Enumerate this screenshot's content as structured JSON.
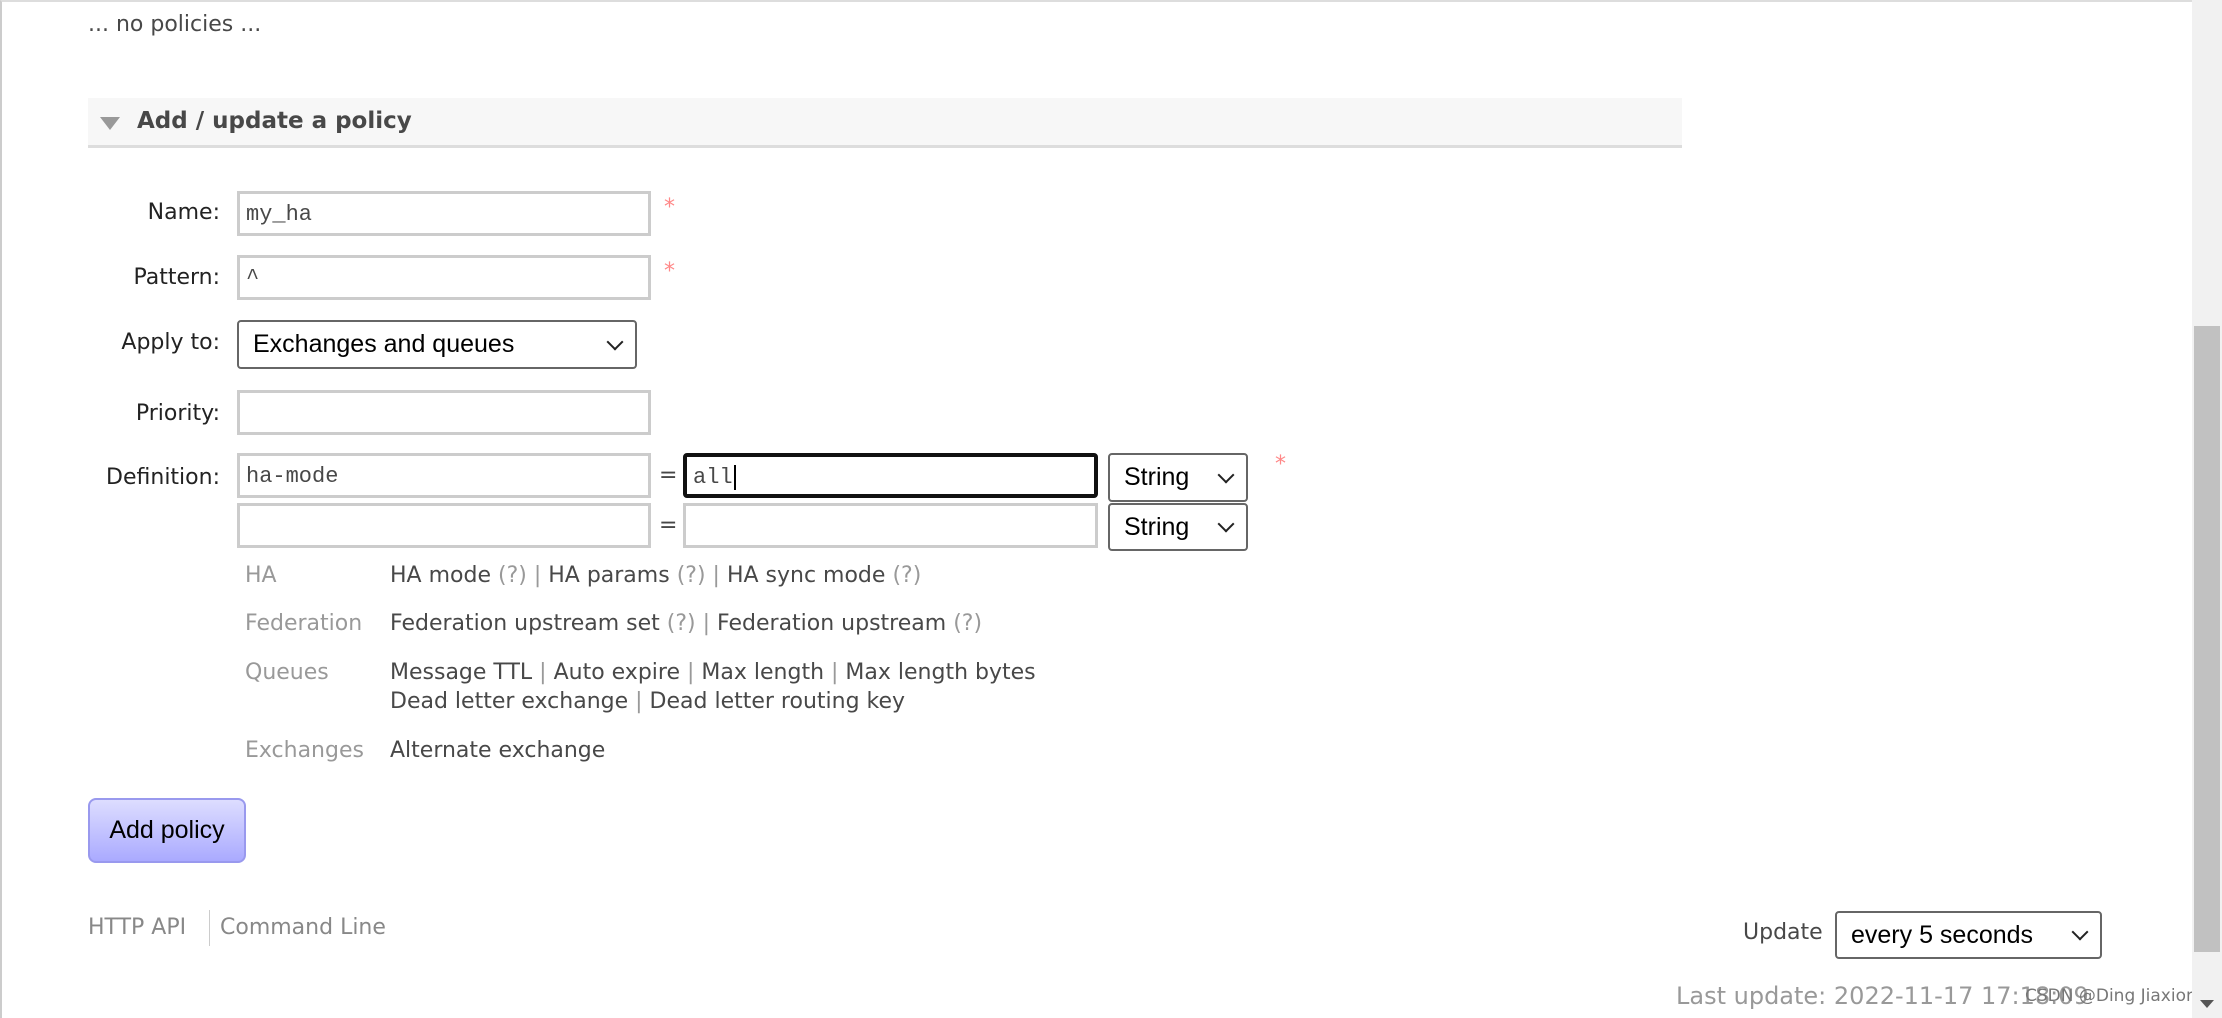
{
  "no_policies_text": "... no policies ...",
  "section": {
    "title": "Add / update a policy"
  },
  "form": {
    "name": {
      "label": "Name:",
      "value": "my_ha",
      "required_mark": "*"
    },
    "pattern": {
      "label": "Pattern:",
      "value": "^",
      "required_mark": "*"
    },
    "apply_to": {
      "label": "Apply to:",
      "selected": "Exchanges and queues"
    },
    "priority": {
      "label": "Priority:",
      "value": ""
    },
    "definition": {
      "label": "Definition:",
      "required_mark": "*",
      "rows": [
        {
          "key": "ha-mode",
          "eq": "=",
          "value": "all",
          "type": "String"
        },
        {
          "key": "",
          "eq": "=",
          "value": "",
          "type": "String"
        }
      ]
    }
  },
  "help": [
    {
      "category": "HA",
      "lines": [
        [
          {
            "t": "HA mode",
            "q": "(?)"
          },
          {
            "t": "HA params",
            "q": "(?)"
          },
          {
            "t": "HA sync mode",
            "q": "(?)"
          }
        ]
      ]
    },
    {
      "category": "Federation",
      "lines": [
        [
          {
            "t": "Federation upstream set",
            "q": "(?)"
          },
          {
            "t": "Federation upstream",
            "q": "(?)"
          }
        ]
      ]
    },
    {
      "category": "Queues",
      "lines": [
        [
          {
            "t": "Message TTL"
          },
          {
            "t": "Auto expire"
          },
          {
            "t": "Max length"
          },
          {
            "t": "Max length bytes"
          }
        ],
        [
          {
            "t": "Dead letter exchange"
          },
          {
            "t": "Dead letter routing key"
          }
        ]
      ]
    },
    {
      "category": "Exchanges",
      "lines": [
        [
          {
            "t": "Alternate exchange"
          }
        ]
      ]
    }
  ],
  "add_button": "Add policy",
  "footer": {
    "links": [
      "HTTP API",
      "Command Line"
    ],
    "update_label": "Update",
    "update_selected": "every 5 seconds",
    "last_update": "Last update: 2022-11-17 17:18:09",
    "watermark": "CSDN @Ding Jiaxiong"
  },
  "colors": {
    "button_bg": "#bbbbff",
    "required": "#ff8888",
    "header_bg": "#f7f7f7"
  }
}
